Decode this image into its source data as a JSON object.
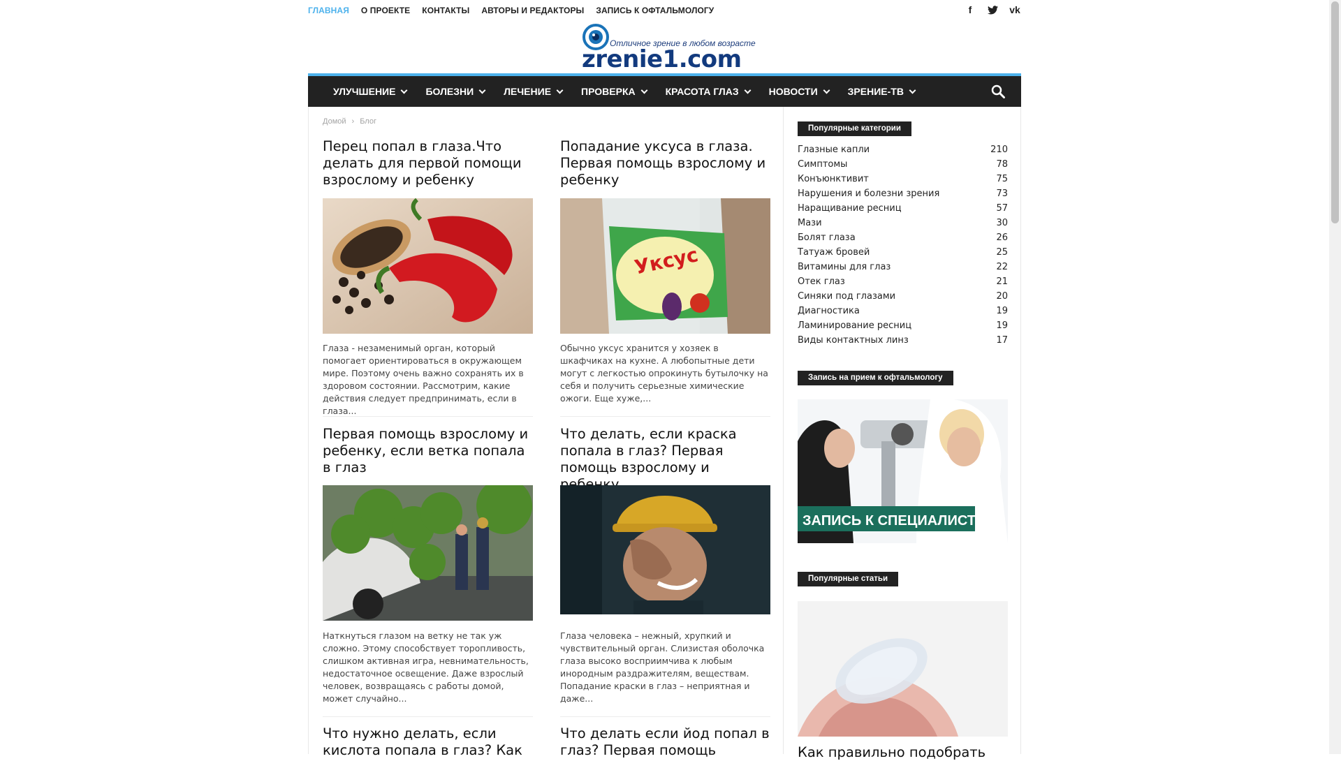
{
  "topmenu": {
    "items": [
      "ГЛАВНАЯ",
      "О ПРОЕКТЕ",
      "КОНТАКТЫ",
      "АВТОРЫ И РЕДАКТОРЫ",
      "ЗАПИСЬ К ОФТАЛЬМОЛОГУ"
    ]
  },
  "social": {
    "facebook": "f",
    "twitter": "t",
    "vk": "vk"
  },
  "logo": {
    "tagline": "Отличное зрение в любом возрасте",
    "name": "zrenie1.com"
  },
  "nav": {
    "items": [
      "УЛУЧШЕНИЕ",
      "БОЛЕЗНИ",
      "ЛЕЧЕНИЕ",
      "ПРОВЕРКА",
      "КРАСОТА ГЛАЗ",
      "НОВОСТИ",
      "ЗРЕНИЕ-ТВ"
    ]
  },
  "breadcrumb": {
    "home": "Домой",
    "separator": "›",
    "current": "Блог"
  },
  "articles": [
    {
      "title": "Перец попал в глаза.Что делать для первой помощи взрослому и ребенку",
      "excerpt": "Глаза - незаменимый орган, который помогает ориентироваться в окружающем мире. Поэтому очень важно сохранять их в здоровом состоянии. Рассмотрим, какие действия следует предпринимать, если в глаза..."
    },
    {
      "title": "Попадание уксуса в глаза. Первая помощь взрослому и ребенку",
      "excerpt": "Обычно уксус хранится у хозяек в шкафчиках на кухне. А любопытные дети могут с легкостью опрокинуть бутылочку на себя и получить серьезные химические ожоги. Еще хуже,..."
    },
    {
      "title": "Первая помощь взрослому и ребенку, если ветка попала в глаз",
      "excerpt": "Наткнуться глазом на ветку не так уж сложно. Этому способствует торопливость, слишком активная игра, невнимательность, недостаточное освещение. Даже взрослый человек, возвращаясь с работы домой, может случайно..."
    },
    {
      "title": "Что делать, если краска попала в глаз? Первая помощь взрослому и ребенку",
      "excerpt": "Глаза человека – нежный, хрупкий и чувствительный орган. Слизистая оболочка глаза высоко восприимчива к любым инородным раздражителям, веществам. Попадание краски в глаз – неприятная и даже..."
    },
    {
      "title": "Что нужно делать, если кислота попала в глаз? Как"
    },
    {
      "title": "Что делать если йод попал в глаз? Первая помощь"
    }
  ],
  "vinegar_label": "Уксус",
  "sidebar": {
    "categories_title": "Популярные категории",
    "categories": [
      {
        "name": "Глазные капли",
        "count": "210"
      },
      {
        "name": "Симптомы",
        "count": "78"
      },
      {
        "name": "Конъюнктивит",
        "count": "75"
      },
      {
        "name": "Нарушения и болезни зрения",
        "count": "73"
      },
      {
        "name": "Наращивание ресниц",
        "count": "57"
      },
      {
        "name": "Мази",
        "count": "30"
      },
      {
        "name": "Болят глаза",
        "count": "26"
      },
      {
        "name": "Татуаж бровей",
        "count": "25"
      },
      {
        "name": "Витамины для глаз",
        "count": "22"
      },
      {
        "name": "Отек глаз",
        "count": "21"
      },
      {
        "name": "Синяки под глазами",
        "count": "20"
      },
      {
        "name": "Диагностика",
        "count": "19"
      },
      {
        "name": "Ламинирование ресниц",
        "count": "19"
      },
      {
        "name": "Виды контактных линз",
        "count": "17"
      }
    ],
    "appointment_title": "Запись на прием к офтальмологу",
    "banner_text": "ЗАПИСЬ К СПЕЦИАЛИСТУ",
    "popular_title": "Популярные статьи",
    "popular_first": "Как правильно подобрать"
  }
}
